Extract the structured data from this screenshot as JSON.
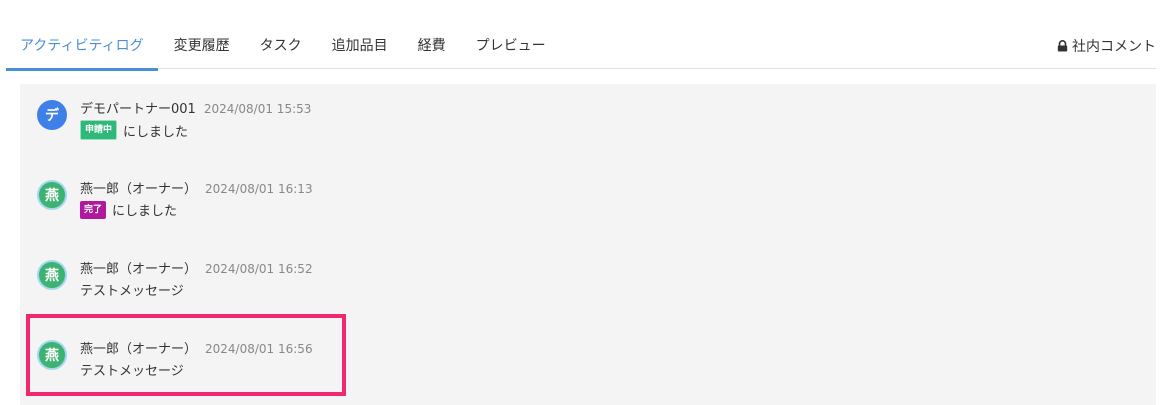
{
  "tabs": [
    {
      "label": "アクティビティログ",
      "active": true
    },
    {
      "label": "変更履歴",
      "active": false
    },
    {
      "label": "タスク",
      "active": false
    },
    {
      "label": "追加品目",
      "active": false
    },
    {
      "label": "経費",
      "active": false
    },
    {
      "label": "プレビュー",
      "active": false
    }
  ],
  "internal_comment": {
    "label": "社内コメント",
    "icon": "lock-icon"
  },
  "entries": [
    {
      "avatar": "デ",
      "avatar_color": "#3f7fe8",
      "author": "デモパートナー001",
      "time": "2024/08/01 15:53",
      "badge": "申請中",
      "badge_color": "#2eb87a",
      "text": "にしました"
    },
    {
      "avatar": "燕",
      "avatar_color": "#3cb371",
      "author": "燕一郎（オーナー）",
      "time": "2024/08/01 16:13",
      "badge": "完了",
      "badge_color": "#b0189d",
      "text": "にしました"
    },
    {
      "avatar": "燕",
      "avatar_color": "#3cb371",
      "author": "燕一郎（オーナー）",
      "time": "2024/08/01 16:52",
      "text": "テストメッセージ"
    },
    {
      "avatar": "燕",
      "avatar_color": "#3cb371",
      "author": "燕一郎（オーナー）",
      "time": "2024/08/01 16:56",
      "text": "テストメッセージ",
      "highlighted": true
    }
  ],
  "colors": {
    "accent": "#4a8fd8",
    "highlight": "#f0286f",
    "feed_background": "#f4f4f4"
  }
}
